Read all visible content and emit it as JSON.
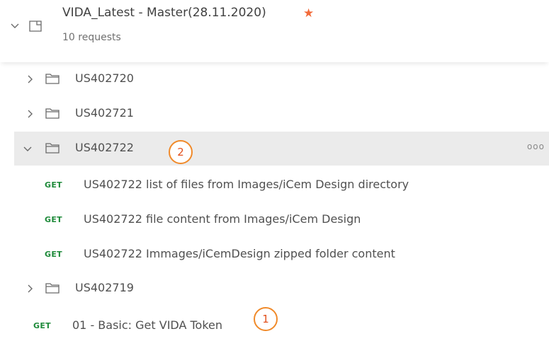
{
  "collection": {
    "title": "VIDA_Latest - Master(28.11.2020)",
    "subtitle": "10 requests",
    "favorite_icon": "star-icon",
    "accent_color": "#f26b3a"
  },
  "folders": [
    {
      "name": "US402720",
      "expanded": false
    },
    {
      "name": "US402721",
      "expanded": false
    },
    {
      "name": "US402722",
      "expanded": true,
      "selected": true
    },
    {
      "name": "US402719",
      "expanded": false
    }
  ],
  "requests": [
    {
      "method": "GET",
      "name": "US402722 list of files from Images/iCem Design directory"
    },
    {
      "method": "GET",
      "name": "US402722 file content from Images/iCem Design"
    },
    {
      "method": "GET",
      "name": "US402722 Immages/iCemDesign zipped folder content"
    },
    {
      "method": "GET",
      "name": "01 - Basic: Get VIDA Token"
    }
  ],
  "annotations": [
    "1",
    "2"
  ],
  "more_menu": "ooo"
}
